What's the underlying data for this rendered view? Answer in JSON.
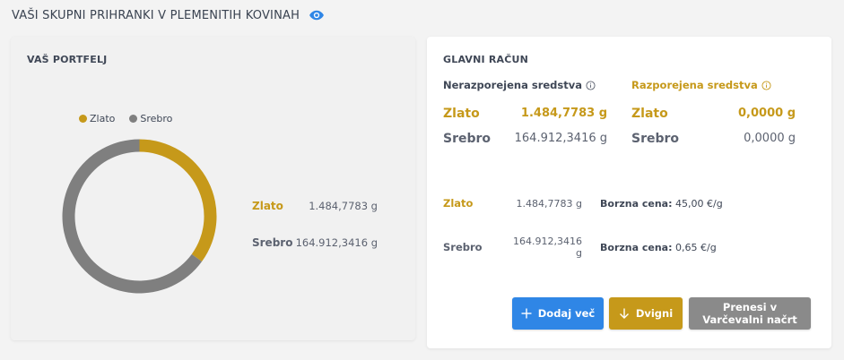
{
  "header": {
    "title": "VAŠI SKUPNI PRIHRANKI V PLEMENITIH KOVINAH",
    "icon": "eye-icon"
  },
  "colors": {
    "gold": "#c6991a",
    "silver": "#7f7f7f",
    "blue": "#2f86e6",
    "grey_button": "#8a8a8a"
  },
  "portfolio": {
    "title": "VAŠ PORTFELJ",
    "legend": [
      {
        "label": "Zlato"
      },
      {
        "label": "Srebro"
      }
    ],
    "rows": [
      {
        "label": "Zlato",
        "value": "1.484,7783 g"
      },
      {
        "label": "Srebro",
        "value": "164.912,3416 g"
      }
    ],
    "chart_data": {
      "type": "pie",
      "categories": [
        "Zlato",
        "Srebro"
      ],
      "values": [
        35,
        65
      ],
      "legend": "top"
    }
  },
  "account": {
    "title": "GLAVNI RAČUN",
    "unallocated": {
      "label": "Nerazporejena sredstva",
      "gold": {
        "label": "Zlato",
        "value": "1.484,7783 g"
      },
      "silver": {
        "label": "Srebro",
        "value": "164.912,3416 g"
      }
    },
    "allocated": {
      "label": "Razporejena sredstva",
      "gold": {
        "label": "Zlato",
        "value": "0,0000 g"
      },
      "silver": {
        "label": "Srebro",
        "value": "0,0000 g"
      }
    },
    "prices": [
      {
        "label": "Zlato",
        "value": "1.484,7783 g",
        "price_label": "Borzna cena:",
        "price": "45,00 €/g"
      },
      {
        "label": "Srebro",
        "value": "164.912,3416 g",
        "price_label": "Borzna cena:",
        "price": "0,65 €/g"
      }
    ],
    "buttons": {
      "add": "Dodaj več",
      "withdraw": "Dvigni",
      "transfer_line1": "Prenesi v",
      "transfer_line2": "Varčevalni načrt"
    }
  }
}
